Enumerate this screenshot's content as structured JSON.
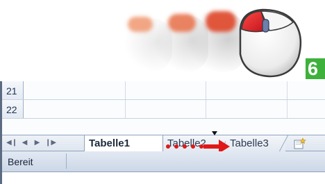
{
  "step": {
    "number": "6"
  },
  "illustration": {
    "icon": "mouse-click-drag-icon",
    "button_color": "#e0202a",
    "badge_color": "#3eb13c"
  },
  "grid": {
    "rows": [
      {
        "number": "21"
      },
      {
        "number": "22"
      }
    ]
  },
  "sheet_nav": {
    "first_icon": "nav-first-icon",
    "prev_icon": "nav-prev-icon",
    "next_icon": "nav-next-icon",
    "last_icon": "nav-last-icon"
  },
  "tabs": [
    {
      "label": "Tabelle1",
      "active": true
    },
    {
      "label": "Tabelle2",
      "active": false
    },
    {
      "label": "Tabelle3",
      "active": false
    }
  ],
  "new_sheet": {
    "icon": "insert-worksheet-icon"
  },
  "drag": {
    "color": "#e01818",
    "icon": "drag-arrow-icon"
  },
  "status": {
    "text": "Bereit"
  }
}
